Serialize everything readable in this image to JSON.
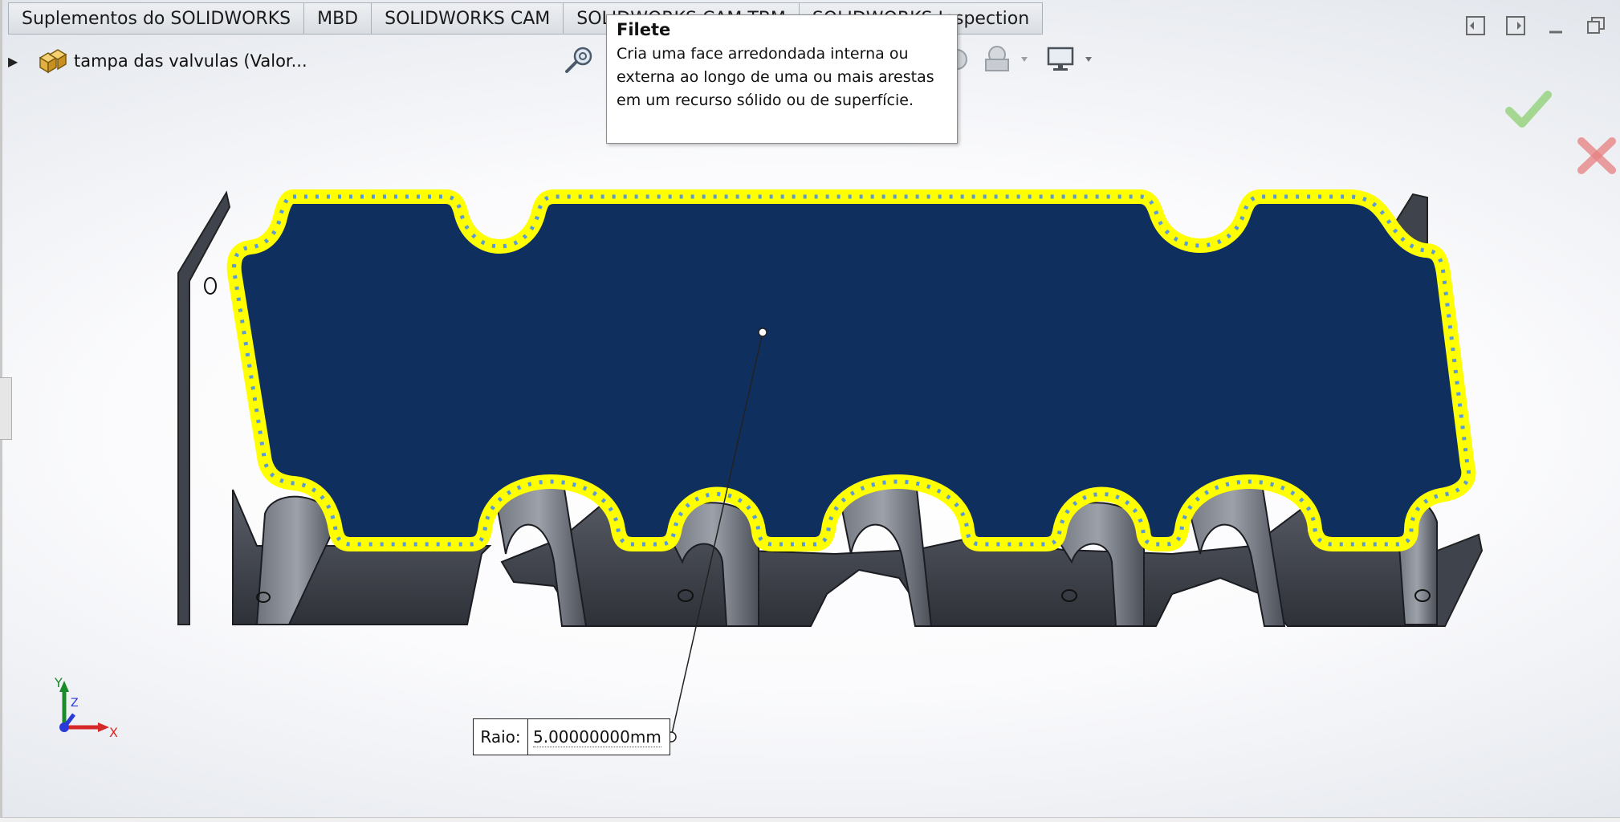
{
  "tabs": [
    {
      "label": "Suplementos do SOLIDWORKS"
    },
    {
      "label": "MBD"
    },
    {
      "label": "SOLIDWORKS CAM"
    },
    {
      "label": "SOLIDWORKS CAM TBM"
    },
    {
      "label": "SOLIDWORKS Inspection"
    }
  ],
  "tree": {
    "part_label": "tampa das valvulas  (Valor...",
    "part_icon": "part-icon",
    "expand_icon": "expand-arrow-icon"
  },
  "tooltip": {
    "title": "Filete",
    "body": "Cria uma face arredondada interna ou externa ao longo de uma ou mais arestas em um recurso sólido ou de superfície."
  },
  "hud_icons": [
    "zoom-to-fit-icon",
    "zoom-to-area-icon",
    "display-style-icon",
    "appearance-icon",
    "view-settings-icon"
  ],
  "confirm": {
    "ok_icon": "ok-check-icon",
    "cancel_icon": "cancel-x-icon"
  },
  "window_controls": [
    "tile-left-icon",
    "tile-right-icon",
    "minimize-icon",
    "restore-icon"
  ],
  "dimension": {
    "label": "Raio:",
    "value": "5.00000000mm"
  },
  "triad": {
    "x": "X",
    "y": "Y",
    "z": "Z"
  },
  "colors": {
    "face_fill": "#0f2f5e",
    "edge_highlight": "#ffff00",
    "edge_blue": "#6fa8dc",
    "body_dark": "#4a4e58",
    "ok_green": "#78c860",
    "cancel_red": "#e06464"
  }
}
